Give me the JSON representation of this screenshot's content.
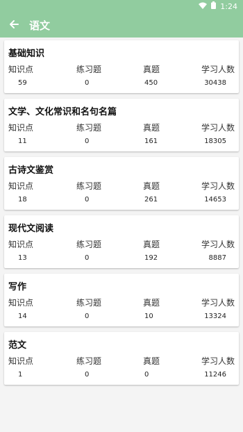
{
  "status_bar": {
    "time": "1:24",
    "wifi_icon": "wifi-icon",
    "battery_icon": "battery-icon"
  },
  "app_bar": {
    "title": "语文",
    "back_icon": "arrow-left-icon",
    "color": "#91cc9f"
  },
  "columns": [
    "知识点",
    "练习题",
    "真题",
    "学习人数"
  ],
  "cards": [
    {
      "title": "基础知识",
      "values": [
        "59",
        "0",
        "450",
        "30438"
      ]
    },
    {
      "title": "文学、文化常识和名句名篇",
      "values": [
        "11",
        "0",
        "161",
        "18305"
      ]
    },
    {
      "title": "古诗文鉴赏",
      "values": [
        "18",
        "0",
        "261",
        "14653"
      ]
    },
    {
      "title": "现代文阅读",
      "values": [
        "13",
        "0",
        "192",
        "8887"
      ]
    },
    {
      "title": "写作",
      "values": [
        "14",
        "0",
        "10",
        "13324"
      ]
    },
    {
      "title": "范文",
      "values": [
        "1",
        "0",
        "0",
        "11246"
      ]
    }
  ]
}
